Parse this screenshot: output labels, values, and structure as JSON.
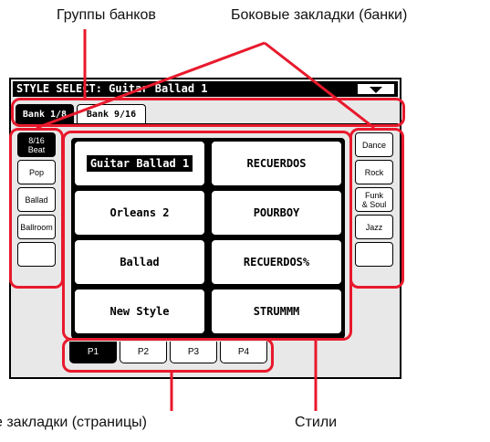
{
  "callouts": {
    "bank_groups": "Группы банков",
    "side_tabs": "Боковые закладки (банки)",
    "bottom_tabs": "е закладки (страницы)",
    "styles": "Стили"
  },
  "window": {
    "title": "STYLE SELECT: Guitar Ballad 1",
    "menu_icon": "triangle-down-icon"
  },
  "bank_groups": [
    {
      "label": "Bank 1/8",
      "active": true
    },
    {
      "label": "Bank 9/16",
      "active": false
    }
  ],
  "left_tabs": [
    {
      "label": "8/16\nBeat",
      "active": true
    },
    {
      "label": "Pop",
      "active": false
    },
    {
      "label": "Ballad",
      "active": false
    },
    {
      "label": "Ballroom",
      "active": false
    }
  ],
  "right_tabs": [
    {
      "label": "Dance"
    },
    {
      "label": "Rock"
    },
    {
      "label": "Funk\n& Soul"
    },
    {
      "label": "Jazz"
    }
  ],
  "styles": [
    {
      "label": "Guitar Ballad 1",
      "selected": true
    },
    {
      "label": "RECUERDOS"
    },
    {
      "label": "Orleans 2"
    },
    {
      "label": "POURBOY"
    },
    {
      "label": "Ballad"
    },
    {
      "label": "RECUERDOS%"
    },
    {
      "label": "New Style"
    },
    {
      "label": "STRUMMM"
    }
  ],
  "pages": [
    {
      "label": "P1",
      "active": true
    },
    {
      "label": "P2"
    },
    {
      "label": "P3"
    },
    {
      "label": "P4"
    }
  ],
  "colors": {
    "highlight": "#e8192c",
    "screen_bg": "#e8e8e8"
  }
}
